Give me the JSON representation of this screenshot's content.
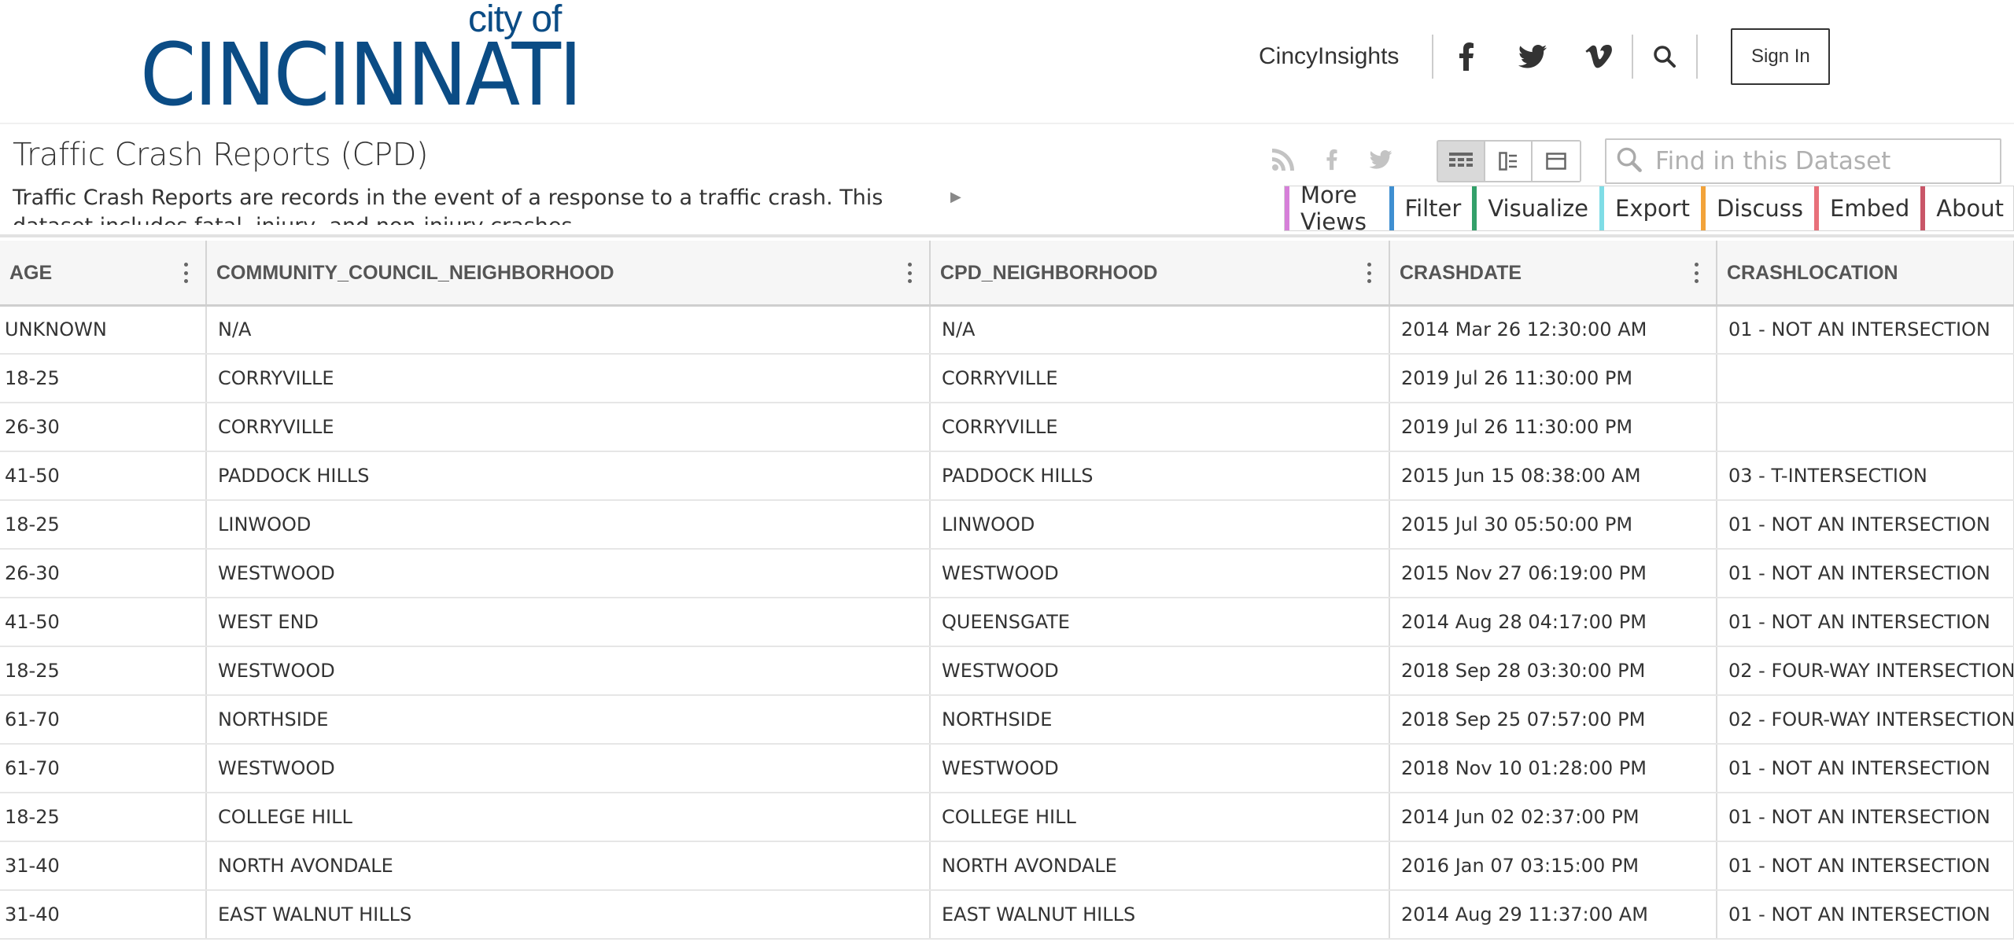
{
  "site": {
    "logo_small": "city of",
    "logo_big": "CINCINNATI",
    "nav_link": "CincyInsights",
    "sign_in": "Sign In",
    "social_icons": [
      "facebook-icon",
      "twitter-icon",
      "vimeo-icon"
    ],
    "brand_color": "#0b4c85"
  },
  "dataset": {
    "title": "Traffic Crash Reports (CPD)",
    "description": "Traffic Crash Reports are records in the event of a response to a traffic crash. This dataset includes fatal, injury, and non-injury crashes.",
    "search_placeholder": "Find in this Dataset",
    "share_icons": [
      "rss-icon",
      "facebook-icon",
      "twitter-icon"
    ],
    "view_modes": [
      "table-view",
      "card-view",
      "single-row-view"
    ],
    "active_view": "table-view",
    "tabs": [
      {
        "label": "More Views",
        "color": "#d67fd9"
      },
      {
        "label": "Filter",
        "color": "#3f8fd1"
      },
      {
        "label": "Visualize",
        "color": "#33a06a"
      },
      {
        "label": "Export",
        "color": "#7fdde6"
      },
      {
        "label": "Discuss",
        "color": "#f2a33a"
      },
      {
        "label": "Embed",
        "color": "#e8707a"
      },
      {
        "label": "About",
        "color": "#c95668"
      }
    ]
  },
  "table": {
    "columns": [
      "AGE",
      "COMMUNITY_COUNCIL_NEIGHBORHOOD",
      "CPD_NEIGHBORHOOD",
      "CRASHDATE",
      "CRASHLOCATION"
    ],
    "rows": [
      [
        "UNKNOWN",
        "N/A",
        "N/A",
        "2014 Mar 26 12:30:00 AM",
        "01 - NOT AN INTERSECTION"
      ],
      [
        "18-25",
        "CORRYVILLE",
        "CORRYVILLE",
        "2019 Jul 26 11:30:00 PM",
        ""
      ],
      [
        "26-30",
        "CORRYVILLE",
        "CORRYVILLE",
        "2019 Jul 26 11:30:00 PM",
        ""
      ],
      [
        "41-50",
        "PADDOCK HILLS",
        "PADDOCK HILLS",
        "2015 Jun 15 08:38:00 AM",
        "03 - T-INTERSECTION"
      ],
      [
        "18-25",
        "LINWOOD",
        "LINWOOD",
        "2015 Jul 30 05:50:00 PM",
        "01 - NOT AN INTERSECTION"
      ],
      [
        "26-30",
        "WESTWOOD",
        "WESTWOOD",
        "2015 Nov 27 06:19:00 PM",
        "01 - NOT AN INTERSECTION"
      ],
      [
        "41-50",
        "WEST END",
        "QUEENSGATE",
        "2014 Aug 28 04:17:00 PM",
        "01 - NOT AN INTERSECTION"
      ],
      [
        "18-25",
        "WESTWOOD",
        "WESTWOOD",
        "2018 Sep 28 03:30:00 PM",
        "02 - FOUR-WAY INTERSECTION"
      ],
      [
        "61-70",
        "NORTHSIDE",
        "NORTHSIDE",
        "2018 Sep 25 07:57:00 PM",
        "02 - FOUR-WAY INTERSECTION"
      ],
      [
        "61-70",
        "WESTWOOD",
        "WESTWOOD",
        "2018 Nov 10 01:28:00 PM",
        "01 - NOT AN INTERSECTION"
      ],
      [
        "18-25",
        "COLLEGE HILL",
        "COLLEGE HILL",
        "2014 Jun 02 02:37:00 PM",
        "01 - NOT AN INTERSECTION"
      ],
      [
        "31-40",
        "NORTH AVONDALE",
        "NORTH AVONDALE",
        "2016 Jan 07 03:15:00 PM",
        "01 - NOT AN INTERSECTION"
      ],
      [
        "31-40",
        "EAST WALNUT HILLS",
        "EAST WALNUT HILLS",
        "2014 Aug 29 11:37:00 AM",
        "01 - NOT AN INTERSECTION"
      ]
    ]
  }
}
